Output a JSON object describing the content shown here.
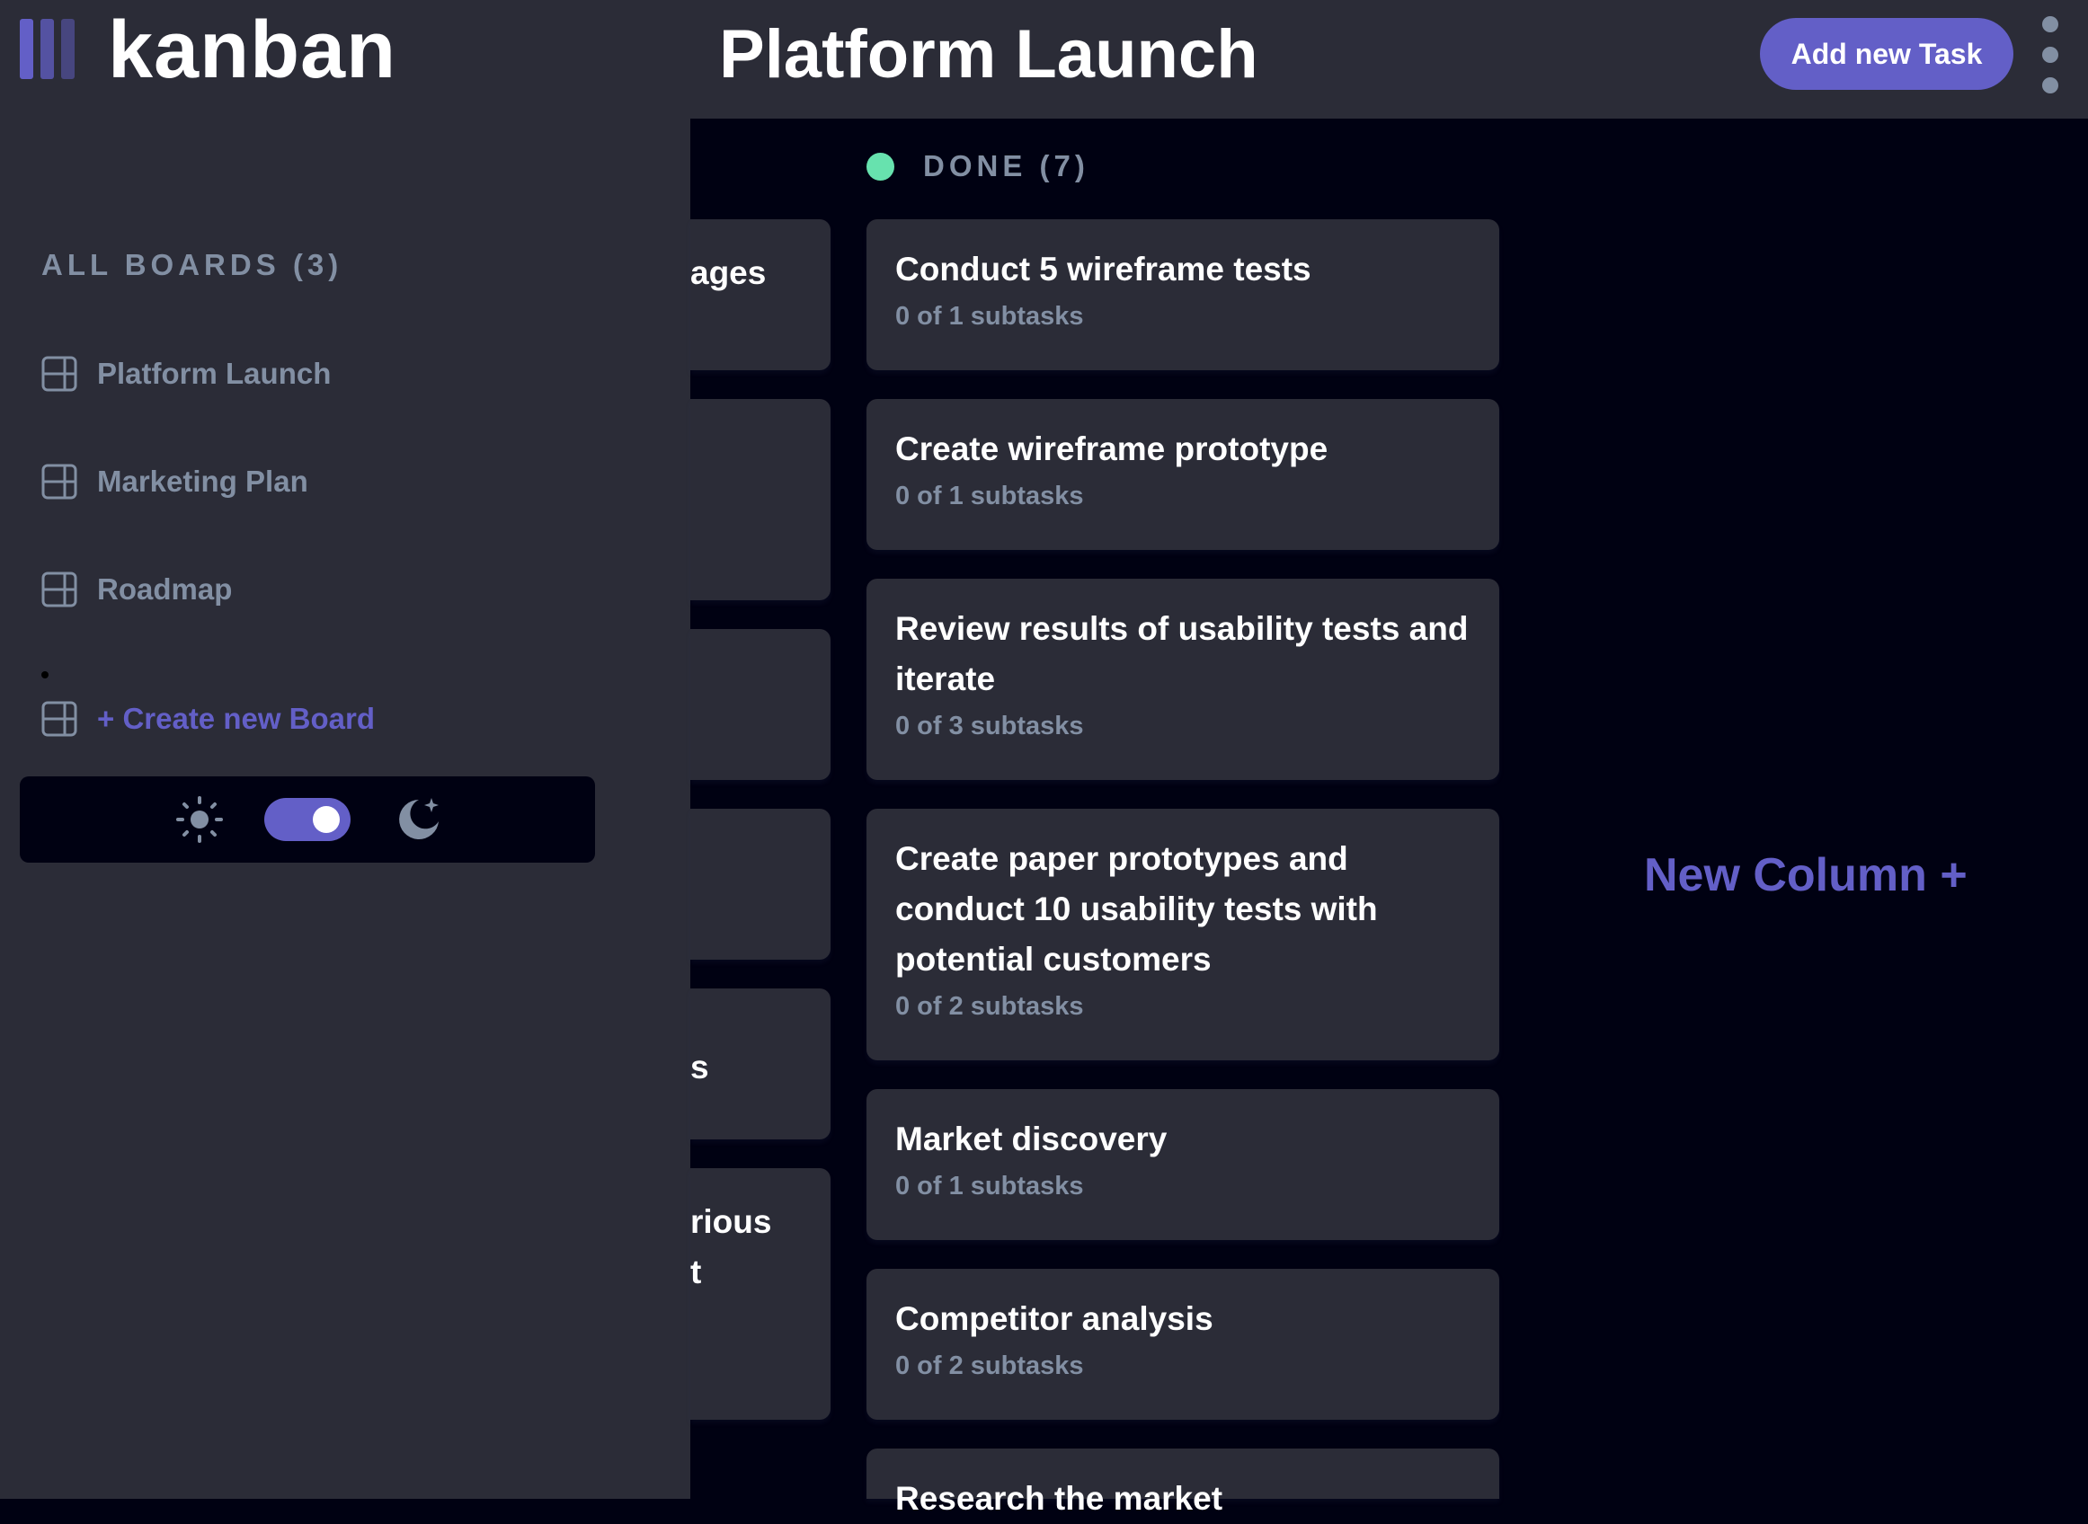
{
  "app": {
    "logo_text": "kanban"
  },
  "header": {
    "board_title": "Platform Launch",
    "add_task_label": "Add new Task"
  },
  "sidebar": {
    "heading": "ALL BOARDS (3)",
    "boards": [
      {
        "label": "Platform Launch"
      },
      {
        "label": "Marketing Plan"
      },
      {
        "label": "Roadmap"
      }
    ],
    "create_label": "+ Create new Board",
    "theme": {
      "mode": "dark"
    }
  },
  "partial_column": {
    "visible_fragments": [
      "ages",
      "s",
      "rious",
      "t"
    ]
  },
  "done_column": {
    "title": "DONE (7)",
    "dot_color": "#67e2ae",
    "tasks": [
      {
        "title": "Conduct 5 wireframe tests",
        "subtasks": "0 of 1 subtasks"
      },
      {
        "title": "Create wireframe prototype",
        "subtasks": "0 of 1 subtasks"
      },
      {
        "title": "Review results of usability tests and iterate",
        "subtasks": "0 of 3 subtasks"
      },
      {
        "title": "Create paper prototypes and conduct 10 usability tests with potential customers",
        "subtasks": "0 of 2 subtasks"
      },
      {
        "title": "Market discovery",
        "subtasks": "0 of 1 subtasks"
      },
      {
        "title": "Competitor analysis",
        "subtasks": "0 of 2 subtasks"
      },
      {
        "title": "Research the market",
        "subtasks": ""
      }
    ]
  },
  "new_column_label": "New Column +",
  "colors": {
    "accent": "#635fc7",
    "surface": "#2b2c37",
    "background": "#000112",
    "muted": "#828fa3"
  }
}
